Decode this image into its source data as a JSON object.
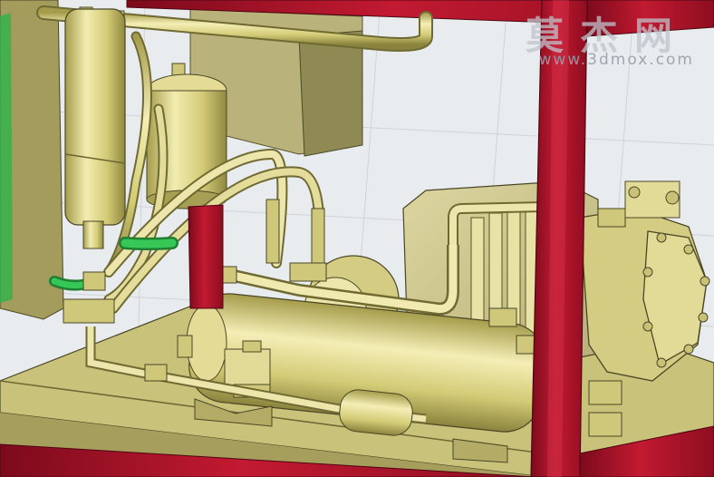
{
  "watermark": {
    "chinese": "莫杰网",
    "url": "www.3dmox.com"
  },
  "colors": {
    "frame_red": "#b0122a",
    "brass": "#d6cf7c",
    "brass_dark": "#9e9648",
    "base_plate": "#c9c27a",
    "green_hose": "#2db34a",
    "background": "#e9ecef",
    "grid_line": "#cfd4d9"
  },
  "icons": {
    "compressor": "compressor-icon",
    "receiver_tank": "receiver-tank-icon",
    "filter_drier": "filter-drier-icon"
  }
}
